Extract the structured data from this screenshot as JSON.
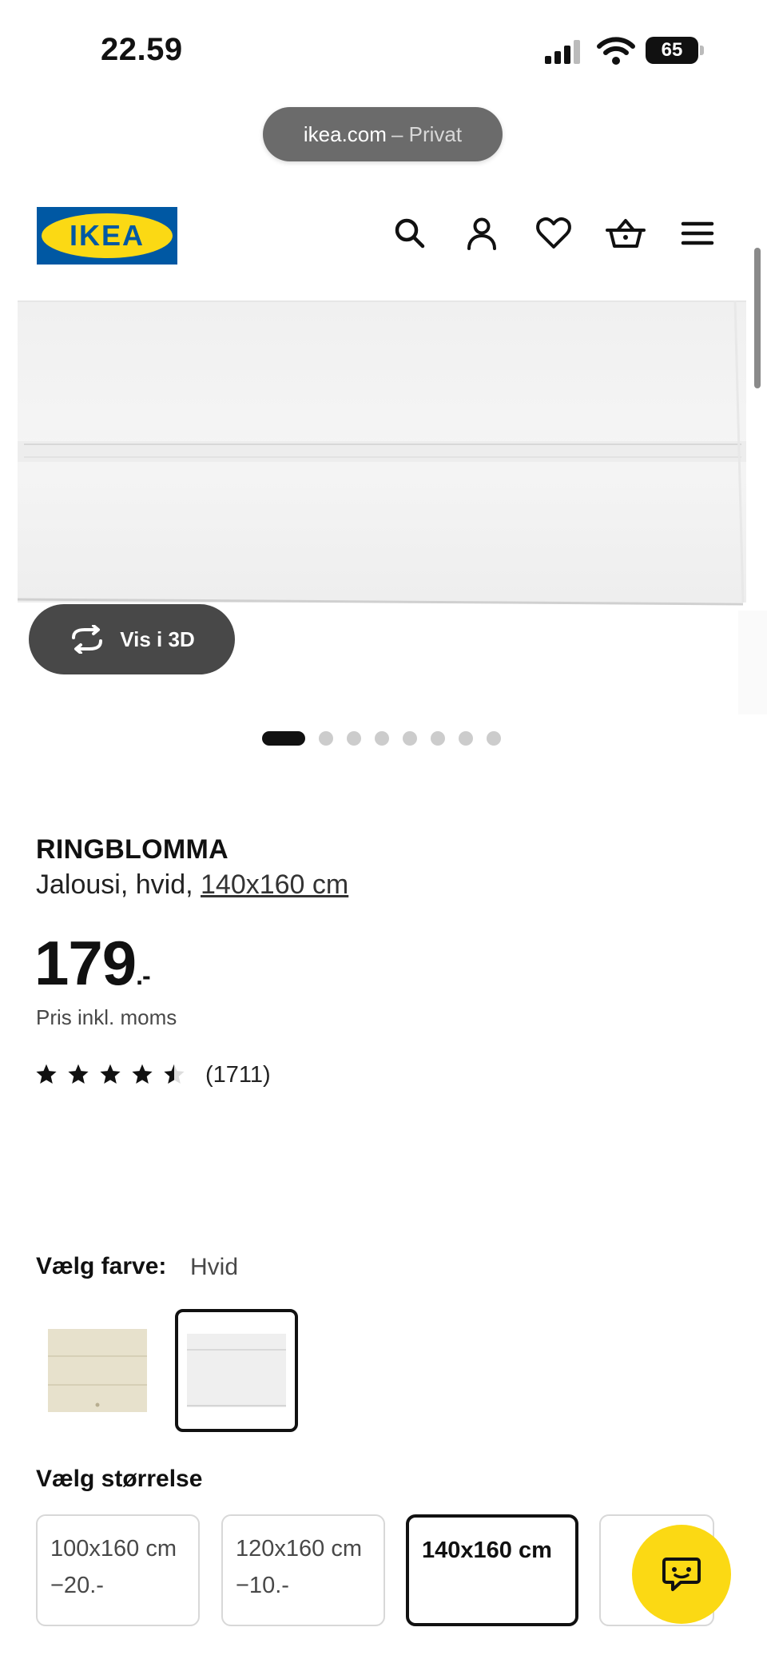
{
  "status_bar": {
    "time": "22.59",
    "battery": "65",
    "icons": [
      "cellular-signal-icon",
      "wifi-icon",
      "battery-icon"
    ]
  },
  "browser": {
    "domain": "ikea.com",
    "mode": "– Privat"
  },
  "header": {
    "logo_text": "IKEA",
    "icons": [
      "search-icon",
      "user-icon",
      "heart-icon",
      "basket-icon",
      "menu-icon"
    ]
  },
  "gallery": {
    "vis3d_label": "Vis i 3D",
    "slide_count": 8,
    "active_slide": 1
  },
  "product": {
    "name": "RINGBLOMMA",
    "desc_prefix": "Jalousi, hvid, ",
    "desc_size": "140x160 cm",
    "price": "179",
    "price_suffix": ".-",
    "price_note": "Pris inkl. moms",
    "rating": 4.5,
    "review_count": "(1711)"
  },
  "color_select": {
    "label": "Vælg farve:",
    "value": "Hvid",
    "options": [
      "beige",
      "hvid"
    ],
    "selected": "hvid"
  },
  "size_select": {
    "label": "Vælg størrelse",
    "options": [
      {
        "size": "100x160 cm",
        "discount": "−20.-"
      },
      {
        "size": "120x160 cm",
        "discount": "−10.-"
      },
      {
        "size": "140x160 cm",
        "discount": ""
      }
    ],
    "selected": "140x160 cm"
  },
  "colors": {
    "ikea_blue": "#0058a3",
    "ikea_yellow": "#fbd914",
    "text": "#111111",
    "muted": "#484848"
  }
}
